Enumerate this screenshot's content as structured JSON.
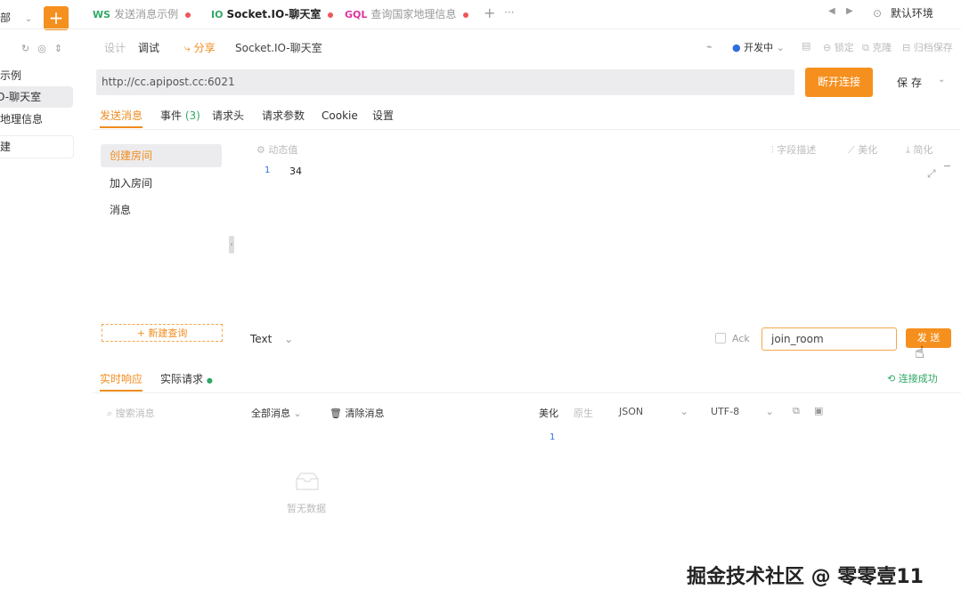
{
  "sidebar": {
    "filter_label": "全部",
    "add_label": "+",
    "items": [
      {
        "label": "示例"
      },
      {
        "label": "O-聊天室"
      },
      {
        "label": "地理信息"
      },
      {
        "label": "建"
      }
    ]
  },
  "tabs": [
    {
      "proto": "WS",
      "label": "发送消息示例",
      "proto_color": "#2fa864"
    },
    {
      "proto": "IO",
      "label": "Socket.IO-聊天室",
      "proto_color": "#2fa864"
    },
    {
      "proto": "GQL",
      "label": "查询国家地理信息",
      "proto_color": "#e0339b"
    }
  ],
  "tab_add": "+",
  "tab_more": "···",
  "env": {
    "label": "默认环境"
  },
  "mode": {
    "design": "设计",
    "debug": "调试",
    "share": "分享",
    "title": "Socket.IO-聊天室"
  },
  "toolbar": {
    "status": "开发中",
    "lock": "锁定",
    "clone": "克隆",
    "save_archive": "归档保存"
  },
  "url": {
    "value": "http://cc.apipost.cc:6021"
  },
  "disconnect_label": "断开连接",
  "save_label": "保存",
  "request_tabs": {
    "send": "发送消息",
    "events": "事件",
    "events_count": "(3)",
    "headers": "请求头",
    "params": "请求参数",
    "cookie": "Cookie",
    "settings": "设置"
  },
  "events_list": [
    {
      "label": "创建房间"
    },
    {
      "label": "加入房间"
    },
    {
      "label": "消息"
    }
  ],
  "new_event": "+ 新建查询",
  "editor": {
    "dynamic_label": "动态值",
    "field_desc": "字段描述",
    "beautify": "美化",
    "simplify": "简化",
    "line_no": "1",
    "content": "34"
  },
  "send_bar": {
    "format": "Text",
    "ack_label": "Ack",
    "event_value": "join_room",
    "send_label": "发 送"
  },
  "response": {
    "tab_actual": "实时响应",
    "tab_request": "实际请求",
    "connected": "连接成功",
    "search_placeholder": "搜索消息",
    "all_messages": "全部消息",
    "clear": "清除消息",
    "beautify": "美化",
    "raw": "原生",
    "format": "JSON",
    "encoding": "UTF-8",
    "line_no": "1",
    "empty": "暂无数据"
  },
  "watermark": "掘金技术社区 @ 零零壹11"
}
